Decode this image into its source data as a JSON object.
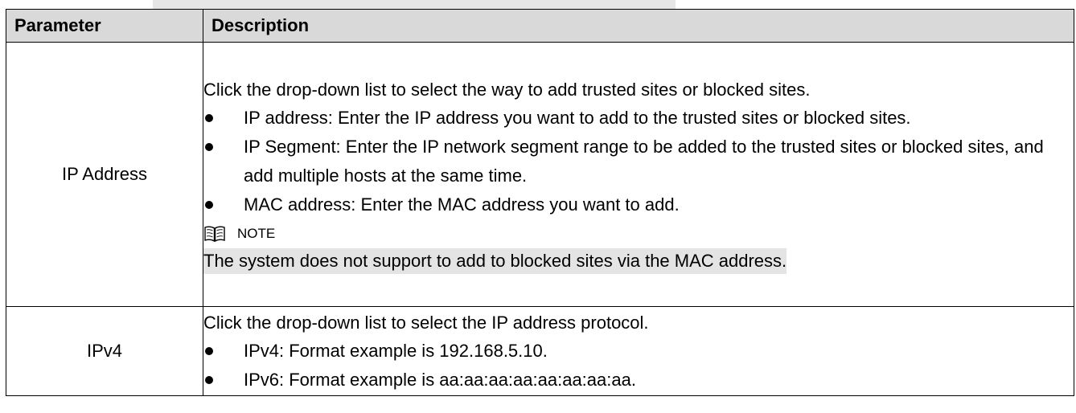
{
  "table": {
    "headers": [
      "Parameter",
      "Description"
    ],
    "rows": [
      {
        "name": "IP Address",
        "intro": "Click the drop-down list to select the way to add trusted sites or blocked sites.",
        "bullets": [
          "IP address: Enter the IP address you want to add to the trusted sites or blocked sites.",
          "IP Segment: Enter the IP network segment range to be added to the trusted sites or blocked sites, and add multiple hosts at the same time.",
          "MAC address: Enter the MAC address you want to add."
        ],
        "note_label": "NOTE",
        "note_text": "The system does not support to add to blocked sites via the MAC address."
      },
      {
        "name": "IPv4",
        "intro": "Click the drop-down list to select the IP address protocol.",
        "bullets": [
          "IPv4: Format example is 192.168.5.10.",
          "IPv6: Format example is aa:aa:aa:aa:aa:aa:aa:aa."
        ]
      }
    ]
  },
  "icons": {
    "note": "book-icon"
  }
}
